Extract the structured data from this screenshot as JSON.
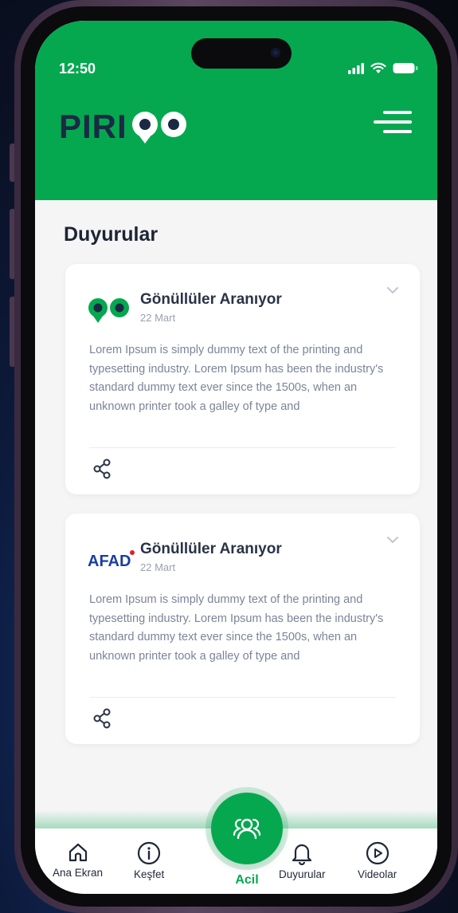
{
  "status_bar": {
    "time": "12:50"
  },
  "header": {
    "logo_text": "PIRI",
    "logo_suffix": "GO"
  },
  "page": {
    "title": "Duyurular"
  },
  "announcements": [
    {
      "source": "go-logo",
      "title": "Gönüllüler Aranıyor",
      "date": "22 Mart",
      "body": "Lorem Ipsum is simply dummy text of the printing and typesetting industry. Lorem Ipsum has been the industry's standard dummy text ever since the 1500s, when an unknown printer took a galley of type and"
    },
    {
      "source": "afad-logo",
      "source_text": "AFAD",
      "title": "Gönüllüler Aranıyor",
      "date": "22 Mart",
      "body": "Lorem Ipsum is simply dummy text of the printing and typesetting industry. Lorem Ipsum has been the industry's standard dummy text ever since the 1500s, when an unknown printer took a galley of type and"
    }
  ],
  "tabbar": {
    "items": [
      {
        "label": "Ana Ekran",
        "icon": "home-icon"
      },
      {
        "label": "Keşfet",
        "icon": "info-icon"
      },
      {
        "label": "Acil",
        "icon": "users-icon",
        "active": true
      },
      {
        "label": "Duyurular",
        "icon": "bell-icon"
      },
      {
        "label": "Videolar",
        "icon": "play-icon"
      }
    ]
  },
  "colors": {
    "brand_green": "#05a84f",
    "dark_navy": "#1b2a44",
    "afad_blue": "#1a3fa0",
    "afad_red": "#e11d2a"
  }
}
